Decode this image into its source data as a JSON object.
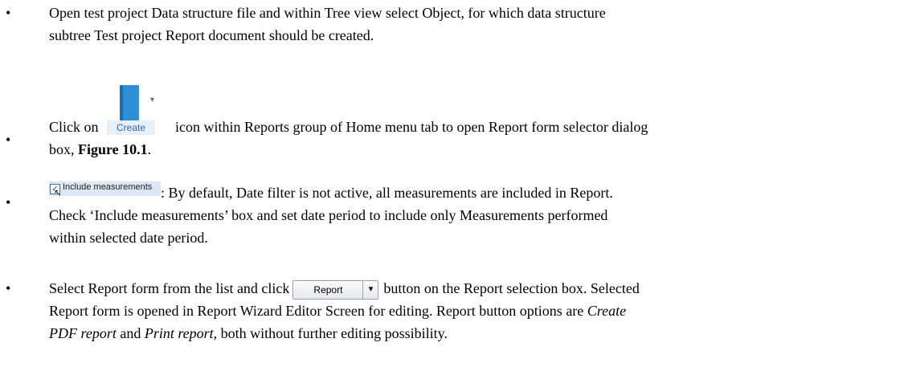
{
  "bullet_char": "•",
  "bullets": [
    {
      "line1": "Open test project Data structure file and within Tree view select Object, for which data structure",
      "line2": "subtree Test project Report document should be created."
    },
    {
      "icon_label": "Create",
      "text_a": "Click on ",
      "text_b": "icon within Reports group of Home menu tab to open Report form selector dialog",
      "line2_a": "box, ",
      "figure_ref": "Figure 10.1",
      "line2_b": "."
    },
    {
      "checkbox_label": "Include measurements",
      "line1": ": By default, Date filter is not active, all measurements are included in Report.",
      "line2": "Check ‘Include measurements’ box and set date period to include only Measurements performed",
      "line3": "within selected date period."
    },
    {
      "text_a": "Select Report form from the list and click",
      "button_label": "Report",
      "text_b": "button on the Report selection box. Selected",
      "line2_a": "Report form is opened in Report Wizard Editor Screen for editing. Report button options are ",
      "line2_i": "Create",
      "line3_i1": "PDF report",
      "line3_b": " and ",
      "line3_i2": "Print report",
      "line3_c": ", both without further editing possibility."
    }
  ]
}
